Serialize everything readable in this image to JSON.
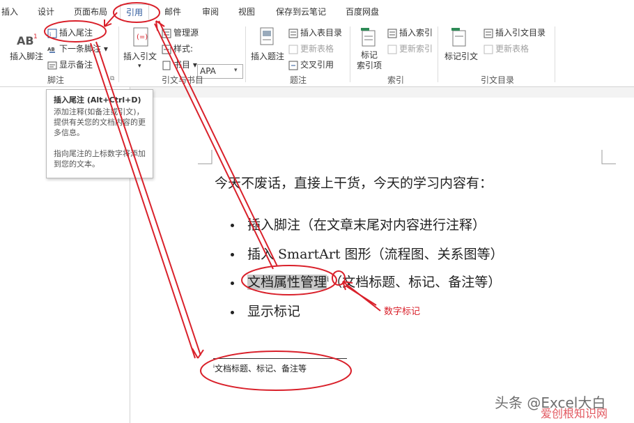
{
  "tabs": [
    "插入",
    "设计",
    "页面布局",
    "引用",
    "邮件",
    "审阅",
    "视图",
    "保存到云笔记",
    "百度网盘"
  ],
  "active_tab": "引用",
  "ribbon": {
    "footnote_group": {
      "insert_footnote": "插入脚注",
      "insert_endnote": "插入尾注",
      "next_footnote": "下一条脚注",
      "show_notes": "显示备注",
      "group_label": "脚注"
    },
    "citation_group": {
      "insert_citation": "插入引文",
      "manage_sources": "管理源",
      "style_label": "样式:",
      "style_value": "APA",
      "bibliography": "书目",
      "group_label": "引文与书目"
    },
    "caption_group": {
      "insert_caption": "插入题注",
      "insert_table_of_figures": "插入表目录",
      "update_table": "更新表格",
      "cross_reference": "交叉引用",
      "group_label": "题注"
    },
    "index_group": {
      "mark_entry": "标记\n索引项",
      "insert_index": "插入索引",
      "update_index": "更新索引",
      "group_label": "索引"
    },
    "toa_group": {
      "mark_citation": "标记引文",
      "insert_toa": "插入引文目录",
      "update_table": "更新表格",
      "group_label": "引文目录"
    }
  },
  "tooltip": {
    "title": "插入尾注 (Alt+Ctrl+D)",
    "desc1": "添加注释(如备注或引文)，提供有关您的文档内容的更多信息。",
    "desc2": "指向尾注的上标数字将添加到您的文本。"
  },
  "document": {
    "intro": "今天不废话，直接上干货，今天的学习内容有：",
    "item1": "插入脚注（在文章末尾对内容进行注释）",
    "item2": "插入 SmartArt 图形（流程图、关系图等）",
    "item3_highlight": "文档属性管理",
    "item3_mark": "i",
    "item3_rest": "（文档标题、标记、备注等）",
    "item4": "显示标记",
    "endnote_mark": "i",
    "endnote_text": "文档标题、标记、备注等"
  },
  "annotation_label": "数字标记",
  "watermark": "头条 @Excel大白",
  "watermark2": "爱创根知识网",
  "colors": {
    "annotation_red": "#d9202a",
    "tab_blue": "#2b579a"
  }
}
